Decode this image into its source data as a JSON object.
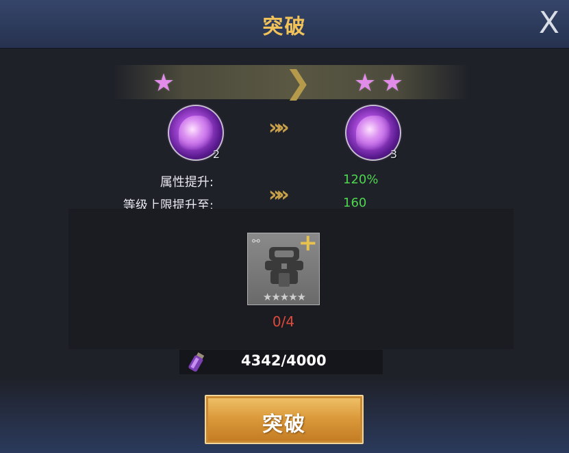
{
  "header": {
    "title": "突破",
    "close_glyph": "X"
  },
  "stars": {
    "before_count": 1,
    "after_count": 2,
    "glyph": "★",
    "star_color": "#e08ce8"
  },
  "beast": {
    "before_level": "2",
    "after_level": "3",
    "icon": "purple-lion-icon"
  },
  "stats": [
    {
      "label": "属性提升:",
      "value": "120%"
    },
    {
      "label": "等级上限提升至:",
      "value": "160"
    }
  ],
  "arrows_glyph": "»»",
  "material": {
    "icon": "armor-icon",
    "stars": "★★★★★",
    "count": "0/4",
    "count_color": "#e04a3c"
  },
  "cost": {
    "icon": "potion-vial-icon",
    "amount": "4342/4000"
  },
  "action_button": {
    "label": "突破"
  },
  "colors": {
    "title": "#f1c25a",
    "stat_value": "#4fd64f",
    "button": "#dc9b3c"
  }
}
